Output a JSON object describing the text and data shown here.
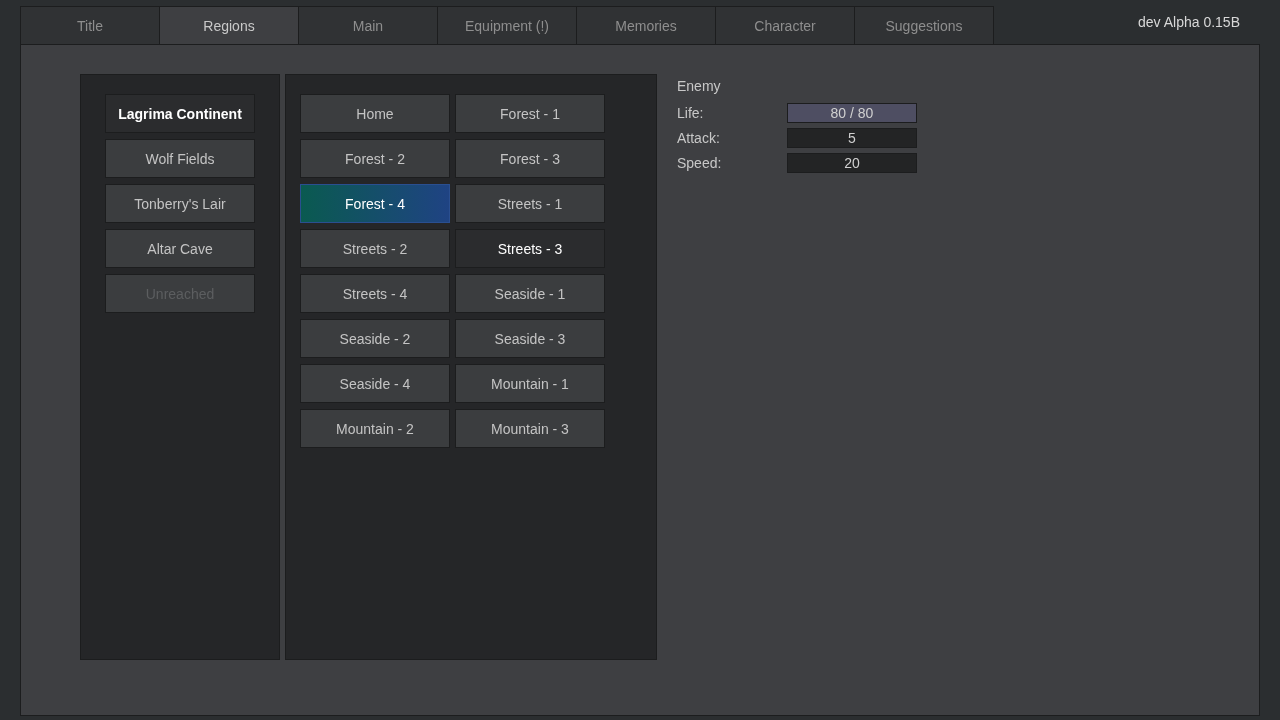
{
  "tabs": [
    {
      "label": "Title",
      "selected": false
    },
    {
      "label": "Regions",
      "selected": true
    },
    {
      "label": "Main",
      "selected": false
    },
    {
      "label": "Equipment (!)",
      "selected": false
    },
    {
      "label": "Memories",
      "selected": false
    },
    {
      "label": "Character",
      "selected": false
    },
    {
      "label": "Suggestions",
      "selected": false
    }
  ],
  "version": "dev Alpha 0.15B",
  "regions": [
    {
      "label": "Lagrima Continent",
      "selected": true,
      "disabled": false
    },
    {
      "label": "Wolf Fields",
      "selected": false,
      "disabled": false
    },
    {
      "label": "Tonberry's Lair",
      "selected": false,
      "disabled": false
    },
    {
      "label": "Altar Cave",
      "selected": false,
      "disabled": false
    },
    {
      "label": "Unreached",
      "selected": false,
      "disabled": true
    }
  ],
  "zones": [
    {
      "label": "Home",
      "selected": false,
      "current": false
    },
    {
      "label": "Forest - 1",
      "selected": false,
      "current": false
    },
    {
      "label": "Forest - 2",
      "selected": false,
      "current": false
    },
    {
      "label": "Forest - 3",
      "selected": false,
      "current": false
    },
    {
      "label": "Forest - 4",
      "selected": false,
      "current": true
    },
    {
      "label": "Streets - 1",
      "selected": false,
      "current": false
    },
    {
      "label": "Streets - 2",
      "selected": false,
      "current": false
    },
    {
      "label": "Streets - 3",
      "selected": true,
      "current": false
    },
    {
      "label": "Streets - 4",
      "selected": false,
      "current": false
    },
    {
      "label": "Seaside - 1",
      "selected": false,
      "current": false
    },
    {
      "label": "Seaside - 2",
      "selected": false,
      "current": false
    },
    {
      "label": "Seaside - 3",
      "selected": false,
      "current": false
    },
    {
      "label": "Seaside - 4",
      "selected": false,
      "current": false
    },
    {
      "label": "Mountain - 1",
      "selected": false,
      "current": false
    },
    {
      "label": "Mountain - 2",
      "selected": false,
      "current": false
    },
    {
      "label": "Mountain - 3",
      "selected": false,
      "current": false
    }
  ],
  "enemy": {
    "title": "Enemy",
    "stats": [
      {
        "kind": "bar",
        "label": "Life:",
        "value": "80 / 80",
        "level": 1
      },
      {
        "kind": "plain",
        "label": "Attack:",
        "value": "5"
      },
      {
        "kind": "plain",
        "label": "Speed:",
        "value": "20"
      }
    ]
  }
}
